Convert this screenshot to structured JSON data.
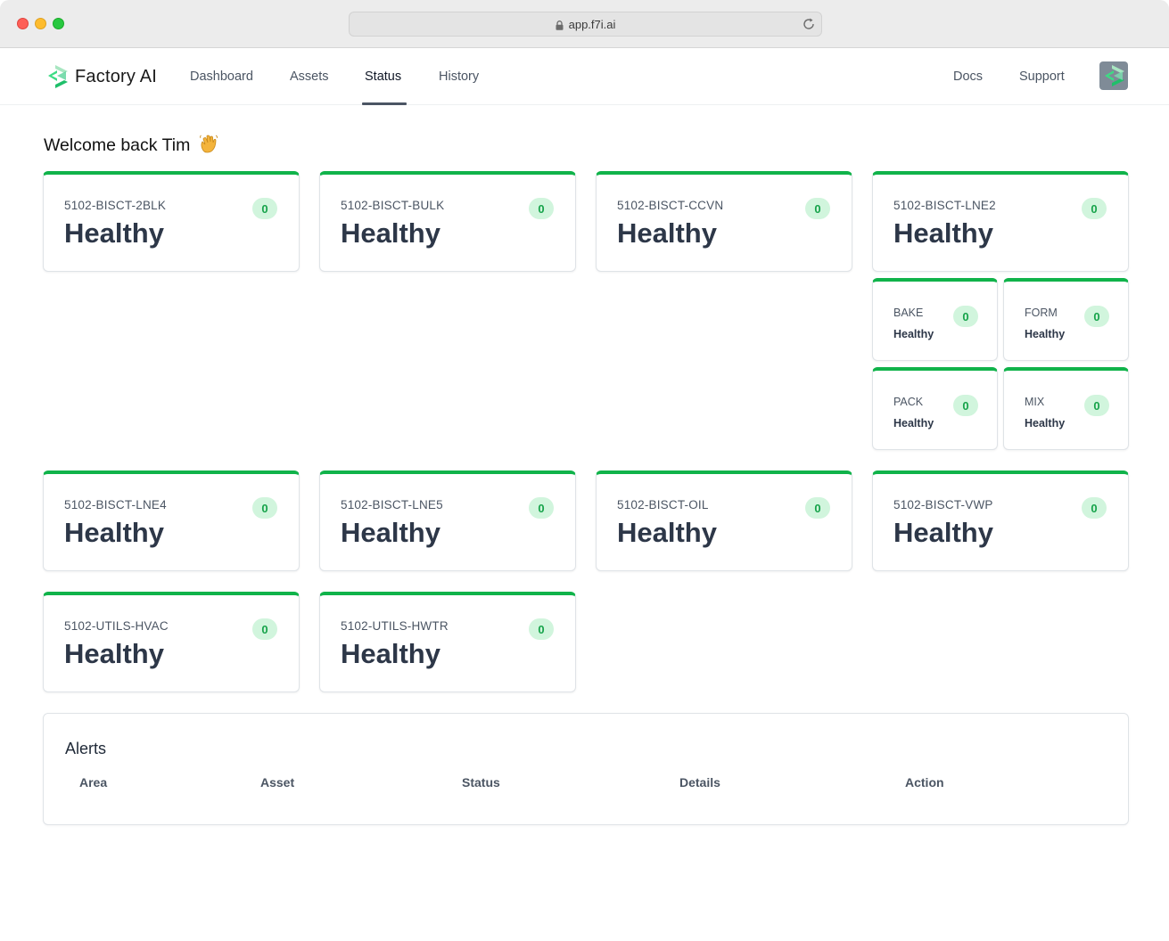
{
  "browser": {
    "url": "app.f7i.ai"
  },
  "nav": {
    "brand": "Factory AI",
    "links": [
      "Dashboard",
      "Assets",
      "Status",
      "History"
    ],
    "active": "Status",
    "right_links": [
      "Docs",
      "Support"
    ]
  },
  "welcome": "Welcome back Tim",
  "assets": [
    {
      "name": "5102-BISCT-2BLK",
      "status": "Healthy",
      "alerts": "0"
    },
    {
      "name": "5102-BISCT-BULK",
      "status": "Healthy",
      "alerts": "0"
    },
    {
      "name": "5102-BISCT-CCVN",
      "status": "Healthy",
      "alerts": "0"
    },
    {
      "name": "5102-BISCT-LNE2",
      "status": "Healthy",
      "alerts": "0"
    },
    {
      "name": "5102-BISCT-LNE4",
      "status": "Healthy",
      "alerts": "0"
    },
    {
      "name": "5102-BISCT-LNE5",
      "status": "Healthy",
      "alerts": "0"
    },
    {
      "name": "5102-BISCT-OIL",
      "status": "Healthy",
      "alerts": "0"
    },
    {
      "name": "5102-BISCT-VWP",
      "status": "Healthy",
      "alerts": "0"
    },
    {
      "name": "5102-UTILS-HVAC",
      "status": "Healthy",
      "alerts": "0"
    },
    {
      "name": "5102-UTILS-HWTR",
      "status": "Healthy",
      "alerts": "0"
    }
  ],
  "subareas": [
    {
      "name": "BAKE",
      "status": "Healthy",
      "alerts": "0"
    },
    {
      "name": "FORM",
      "status": "Healthy",
      "alerts": "0"
    },
    {
      "name": "PACK",
      "status": "Healthy",
      "alerts": "0"
    },
    {
      "name": "MIX",
      "status": "Healthy",
      "alerts": "0"
    }
  ],
  "alerts": {
    "title": "Alerts",
    "columns": [
      "Area",
      "Asset",
      "Status",
      "Details",
      "Action"
    ]
  },
  "colors": {
    "healthy": "#10b34a",
    "badge_bg": "#d1f5dd",
    "badge_text": "#16a34a"
  }
}
